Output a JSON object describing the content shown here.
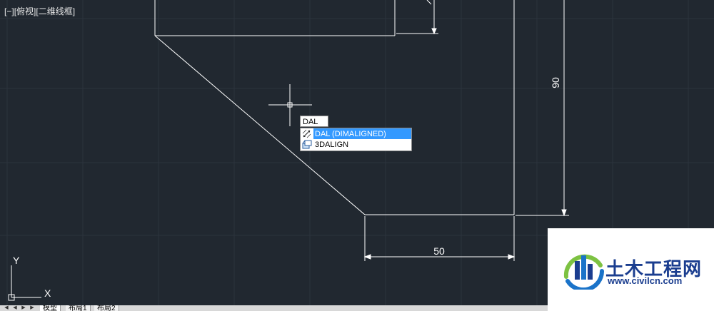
{
  "viewport": {
    "label_minus": "[−]",
    "label_view": "[俯视]",
    "label_style": "[二维线框]"
  },
  "dimensions": {
    "vertical": "90",
    "horizontal": "50"
  },
  "ucs": {
    "x_label": "X",
    "y_label": "Y"
  },
  "command": {
    "input_value": "DAL",
    "suggestions": [
      {
        "label": "DAL (DIMALIGNED)",
        "icon": "dimaligned-icon",
        "selected": true
      },
      {
        "label": "3DALIGN",
        "icon": "3dalign-icon",
        "selected": false
      }
    ]
  },
  "tabs": [
    "模型",
    "布局1",
    "布局2"
  ],
  "watermark": {
    "brand": "土木工程网",
    "url": "www.civilcn.com"
  },
  "colors": {
    "background": "#212830",
    "lines": "#ffffff",
    "highlight": "#3399ff",
    "brand": "#1a3d8f"
  }
}
